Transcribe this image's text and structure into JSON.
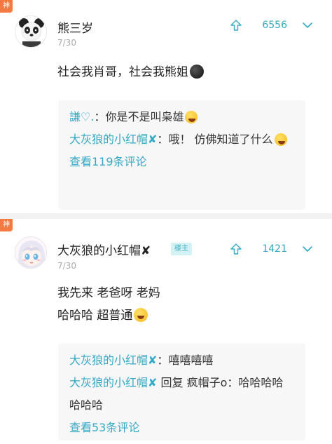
{
  "comments": [
    {
      "badge": "神",
      "username": "熊三岁",
      "date": "7/30",
      "upvotes": "6556",
      "lines": [
        "社会我肖哥，社会我熊姐"
      ],
      "replies": [
        {
          "author": "謙♡.",
          "sep": "：",
          "text": "你是不是叫枭雄"
        },
        {
          "author": "大灰狼的小红帽",
          "mark": "✘",
          "sep": "：",
          "text": "哦！ 仿佛知道了什么"
        }
      ],
      "view_more": "查看119条评论"
    },
    {
      "badge": "神",
      "username": "大灰狼的小红帽",
      "mark": "✘",
      "host_badge": "楼主",
      "date": "7/30",
      "upvotes": "1421",
      "lines": [
        "我先来 老爸呀 老妈",
        "哈哈哈 超普通"
      ],
      "replies": [
        {
          "author": "大灰狼的小红帽",
          "mark": "✘",
          "sep": "：",
          "text": "嘻嘻嘻嘻"
        },
        {
          "author": "大灰狼的小红帽",
          "mark": "✘",
          "sep": " ",
          "text": "回复 疯帽子o：哈哈哈哈哈哈哈"
        }
      ],
      "view_more": "查看53条评论"
    }
  ],
  "icons": {
    "upvote": "arrow-up-icon",
    "downvote": "arrow-down-icon"
  },
  "colors": {
    "accent": "#35a9c5",
    "badge": "#f37a43"
  }
}
